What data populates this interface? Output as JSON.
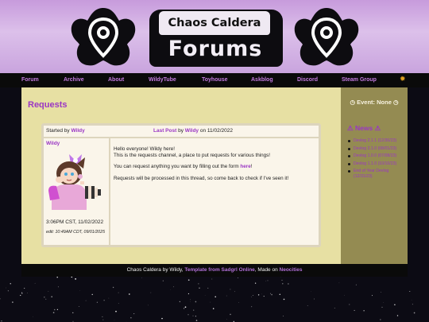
{
  "header": {
    "title_top": "Chaos Caldera",
    "title_bottom": "Forums"
  },
  "nav": {
    "items": [
      "Forum",
      "Archive",
      "About",
      "WildyTube",
      "Toyhouse",
      "Askblog",
      "Discord",
      "Steam Group"
    ],
    "theme_icon": "sun-icon"
  },
  "main": {
    "page_title": "Requests",
    "thread": {
      "started_by_label": "Started by",
      "started_by_user": "Wildy",
      "last_post_label": "Last Post",
      "by_label": "by",
      "last_post_user": "Wildy",
      "on_label": "on",
      "last_post_date": "11/02/2022",
      "post": {
        "username": "Wildy",
        "time": "3:06PM CST, 11/02/2022",
        "edit": "edit: 10:49AM CDT, 09/01/2025",
        "line1": "Hello everyone! Wildy here!",
        "line2": "This is the requests channel, a place to put requests for various things!",
        "line3_pre": "You can request anything you want by filling out the form",
        "line3_link": "here",
        "line3_post": "!",
        "line4": "Requests will be processed in this thread, so come back to check if I've seen it!"
      }
    }
  },
  "sidebar": {
    "event": "Event: None",
    "news_title": "News",
    "news": [
      "Devlog 2.1.1 (12/30/23)",
      "Devlog 2.1.0 (08/01/23)",
      "Devlog 1.0.0 (07/08/23)",
      "Devlog 1.1.0 (10/10/23)",
      "End of Year Devlog (12/31/23)"
    ]
  },
  "footer": {
    "prefix": "Chaos Caldera by Wildy,",
    "template_link": "Template from Sadgrl Online",
    "middle": ", Made on",
    "host_link": "Neocities"
  },
  "colors": {
    "accent": "#9a36c4",
    "main_bg": "#e7e0a3",
    "sidebar_bg": "#948b52",
    "nav_bg": "#0a0a0a"
  }
}
